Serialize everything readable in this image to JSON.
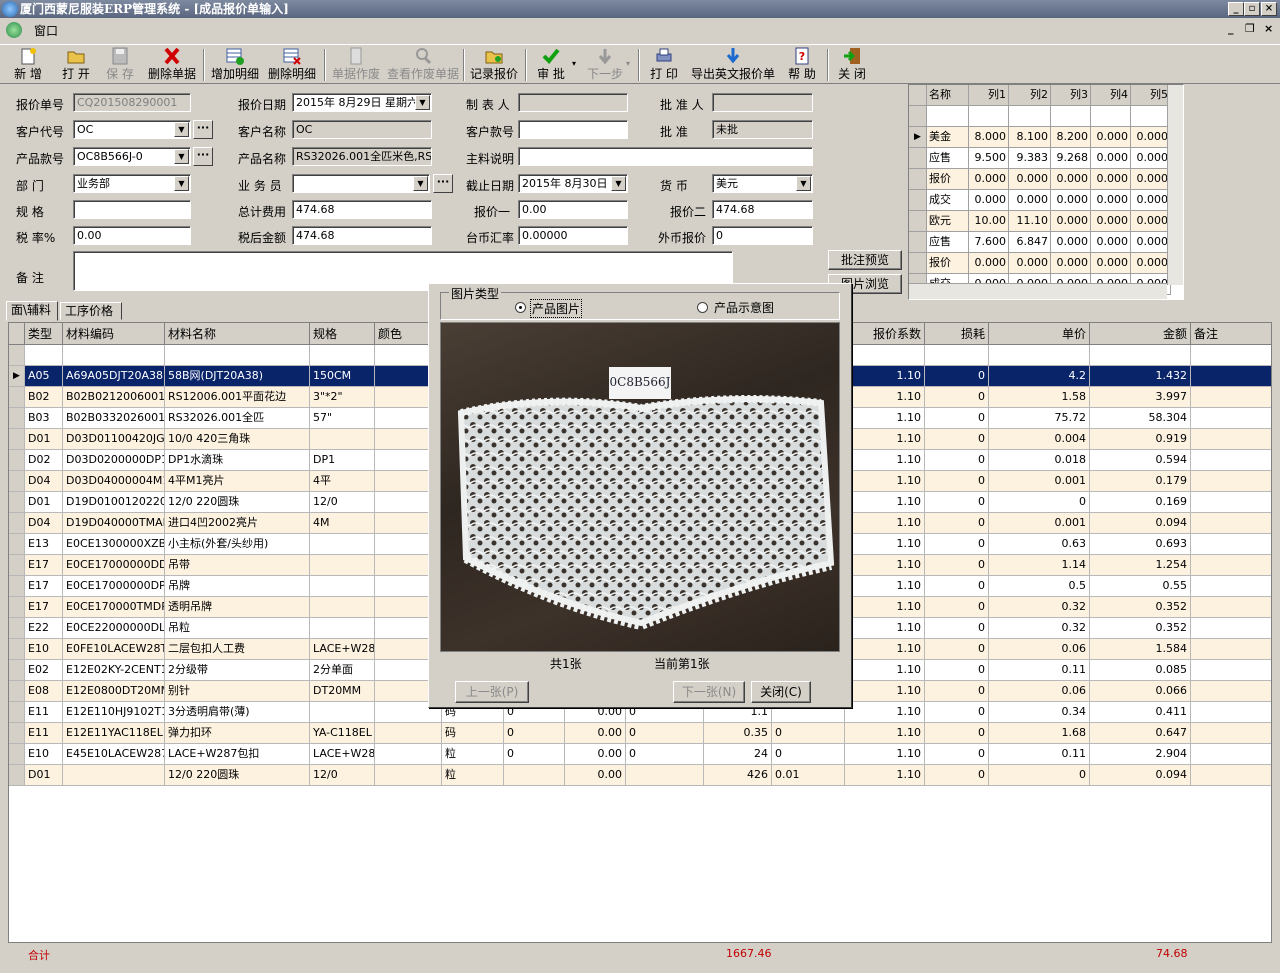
{
  "window": {
    "title": "厦门西蒙尼服装ERP管理系统 - [成品报价单输入]",
    "menu": "窗口"
  },
  "toolbar": [
    {
      "label": "新  增",
      "icon": "new-icon",
      "enabled": true
    },
    {
      "label": "打  开",
      "icon": "open-icon",
      "enabled": true
    },
    {
      "label": "保  存",
      "icon": "save-icon",
      "enabled": false
    },
    {
      "label": "删除单据",
      "icon": "delete-icon",
      "enabled": true
    },
    {
      "label": "增加明细",
      "icon": "add-row-icon",
      "enabled": true
    },
    {
      "label": "删除明细",
      "icon": "delete-row-icon",
      "enabled": true
    },
    {
      "label": "单据作废",
      "icon": "void-icon",
      "enabled": false
    },
    {
      "label": "查看作废单据",
      "icon": "view-void-icon",
      "enabled": false
    },
    {
      "label": "记录报价",
      "icon": "record-icon",
      "enabled": true
    },
    {
      "label": "审  批",
      "icon": "approve-icon",
      "enabled": true
    },
    {
      "label": "下一步",
      "icon": "next-step-icon",
      "enabled": false
    },
    {
      "label": "打  印",
      "icon": "print-icon",
      "enabled": true
    },
    {
      "label": "导出英文报价单",
      "icon": "export-icon",
      "enabled": true
    },
    {
      "label": "帮  助",
      "icon": "help-icon",
      "enabled": true
    },
    {
      "label": "关  闭",
      "icon": "close-icon",
      "enabled": true
    }
  ],
  "form": {
    "quote_no": {
      "label": "报价单号",
      "value": "CQ201508290001"
    },
    "quote_date": {
      "label": "报价日期",
      "value": "2015年 8月29日 星期六"
    },
    "maker": {
      "label": "制 表 人",
      "value": ""
    },
    "approver": {
      "label": "批 准 人",
      "value": ""
    },
    "customer_code": {
      "label": "客户代号",
      "value": "OC"
    },
    "customer_name": {
      "label": "客户名称",
      "value": "OC"
    },
    "customer_style": {
      "label": "客户款号",
      "value": ""
    },
    "approval": {
      "label": "批    准",
      "value": "未批"
    },
    "product_style": {
      "label": "产品款号",
      "value": "OC8B566J-0"
    },
    "product_name": {
      "label": "产品名称",
      "value": "RS32026.001全匹米色,RS1"
    },
    "material_note": {
      "label": "主料说明",
      "value": ""
    },
    "dept": {
      "label": "部    门",
      "value": "业务部"
    },
    "salesman": {
      "label": "业 务 员",
      "value": ""
    },
    "deadline": {
      "label": "截止日期",
      "value": "2015年 8月30日"
    },
    "currency": {
      "label": "货    币",
      "value": "美元"
    },
    "spec": {
      "label": "规    格",
      "value": ""
    },
    "total_cost": {
      "label": "总计费用",
      "value": "474.68"
    },
    "price1": {
      "label": "报价一",
      "value": "0.00"
    },
    "price2": {
      "label": "报价二",
      "value": "474.68"
    },
    "tax_rate": {
      "label": "税    率%",
      "value": "0.00"
    },
    "after_tax": {
      "label": "税后金额",
      "value": "474.68"
    },
    "twd_rate": {
      "label": "台币汇率",
      "value": "0.00000"
    },
    "fx_price": {
      "label": "外币报价",
      "value": "0"
    },
    "remark": {
      "label": "备    注",
      "value": ""
    },
    "approve_preview": "批注预览",
    "photo_browse": "图片浏览"
  },
  "summary_grid": {
    "headers": [
      "名称",
      "列1",
      "列2",
      "列3",
      "列4",
      "列5"
    ],
    "rows": [
      [
        "美金",
        "8.000",
        "8.100",
        "8.200",
        "0.000",
        "0.000"
      ],
      [
        "应售",
        "9.500",
        "9.383",
        "9.268",
        "0.000",
        "0.000"
      ],
      [
        "报价",
        "0.000",
        "0.000",
        "0.000",
        "0.000",
        "0.000"
      ],
      [
        "成交",
        "0.000",
        "0.000",
        "0.000",
        "0.000",
        "0.000"
      ],
      [
        "欧元",
        "10.00",
        "11.10",
        "0.000",
        "0.000",
        "0.000"
      ],
      [
        "应售",
        "7.600",
        "6.847",
        "0.000",
        "0.000",
        "0.000"
      ],
      [
        "报价",
        "0.000",
        "0.000",
        "0.000",
        "0.000",
        "0.000"
      ],
      [
        "成交",
        "0.000",
        "0.000",
        "0.000",
        "0.000",
        "0.000"
      ]
    ]
  },
  "tabs": [
    "面\\辅料",
    "工序价格"
  ],
  "grid": {
    "headers": [
      "类型",
      "材料编码",
      "材料名称",
      "规格",
      "颜色",
      "报价系数",
      "损耗",
      "单价",
      "金额",
      "备注"
    ],
    "rows": [
      [
        "A05",
        "A69A05DJT20A381",
        "58B网(DJT20A38)",
        "150CM",
        "",
        "1.10",
        "0",
        "4.2",
        "1.432",
        ""
      ],
      [
        "B02",
        "B02B02120060011",
        "RS12006.001平面花边",
        "3\"*2\"",
        "",
        "1.10",
        "0",
        "1.58",
        "3.997",
        ""
      ],
      [
        "B03",
        "B02B03320260011",
        "RS32026.001全匹",
        "57\"",
        "",
        "1.10",
        "0",
        "75.72",
        "58.304",
        ""
      ],
      [
        "D01",
        "D03D01100420JG1",
        "10/0 420三角珠",
        "",
        "",
        "1.10",
        "0",
        "0.004",
        "0.919",
        ""
      ],
      [
        "D02",
        "D03D0200000DP11",
        "DP1水滴珠",
        "DP1",
        "",
        "1.10",
        "0",
        "0.018",
        "0.594",
        ""
      ],
      [
        "D04",
        "D03D04000004M11",
        "4平M1亮片",
        "4平",
        "",
        "1.10",
        "0",
        "0.001",
        "0.179",
        ""
      ],
      [
        "D01",
        "D19D01001202201",
        "12/0 220圆珠",
        "12/0",
        "",
        "1.10",
        "0",
        "0",
        "0.169",
        ""
      ],
      [
        "D04",
        "D19D040000TMAP1",
        "进口4凹2002亮片",
        "4M",
        "",
        "1.10",
        "0",
        "0.001",
        "0.094",
        ""
      ],
      [
        "E13",
        "E0CE1300000XZB2",
        "小主标(外套/头纱用)",
        "",
        "",
        "1.10",
        "0",
        "0.63",
        "0.693",
        ""
      ],
      [
        "E17",
        "E0CE17000000DD2",
        "吊带",
        "",
        "",
        "1.10",
        "0",
        "1.14",
        "1.254",
        ""
      ],
      [
        "E17",
        "E0CE17000000DP2",
        "吊牌",
        "",
        "",
        "1.10",
        "0",
        "0.5",
        "0.55",
        ""
      ],
      [
        "E17",
        "E0CE170000TMDP2",
        "透明吊牌",
        "",
        "",
        "1.10",
        "0",
        "0.32",
        "0.352",
        ""
      ],
      [
        "E22",
        "E0CE22000000DL2",
        "吊粒",
        "",
        "",
        "1.10",
        "0",
        "0.32",
        "0.352",
        ""
      ],
      [
        "E10",
        "E0FE10LACEW28T1",
        "二层包扣人工费",
        "LACE+W287",
        "",
        "1.10",
        "0",
        "0.06",
        "1.584",
        ""
      ],
      [
        "E02",
        "E12E02KY-2CENT1",
        "2分级带",
        "2分单面",
        "",
        "1.10",
        "0",
        "0.11",
        "0.085",
        ""
      ],
      [
        "E08",
        "E12E0800DT20MM1",
        "别针",
        "DT20MM",
        "",
        "1.10",
        "0",
        "0.06",
        "0.066",
        ""
      ],
      [
        "E11",
        "E12E110HJ9102T1",
        "3分透明肩带(薄)",
        "",
        "",
        "1.10",
        "0",
        "0.34",
        "0.411",
        ""
      ],
      [
        "E11",
        "E12E11YAC118EL1",
        "弹力扣环",
        "YA-C118EL",
        "",
        "1.10",
        "0",
        "1.68",
        "0.647",
        ""
      ],
      [
        "E10",
        "E45E10LACEW2871",
        "LACE+W287包扣",
        "LACE+W287",
        "",
        "1.10",
        "0",
        "0.11",
        "2.904",
        ""
      ],
      [
        "D01",
        "",
        "12/0 220圆珠",
        "12/0",
        "",
        "1.10",
        "0",
        "0",
        "0.094",
        ""
      ]
    ],
    "mid": [
      [
        "",
        "",
        "",
        "",
        "",
        ""
      ],
      [
        "",
        "",
        "",
        "",
        "",
        ""
      ],
      [
        "",
        "",
        "",
        "",
        "",
        ""
      ],
      [
        "",
        "",
        "",
        "",
        "",
        ""
      ],
      [
        "",
        "",
        "",
        "",
        "",
        ""
      ],
      [
        "",
        "",
        "",
        "",
        "",
        ""
      ],
      [
        "",
        "",
        "",
        "",
        "",
        ""
      ],
      [
        "",
        "",
        "",
        "",
        "",
        ""
      ],
      [
        "",
        "",
        "",
        "",
        "",
        ""
      ],
      [
        "",
        "",
        "",
        "",
        "",
        ""
      ],
      [
        "",
        "",
        "",
        "",
        "",
        ""
      ],
      [
        "",
        "",
        "",
        "",
        "",
        ""
      ],
      [
        "",
        "",
        "",
        "",
        "",
        ""
      ],
      [
        "",
        "",
        "",
        "",
        "",
        ""
      ],
      [
        "",
        "",
        "",
        "",
        "",
        ""
      ],
      [
        "",
        "",
        "",
        "",
        "",
        ""
      ],
      [
        "码",
        "0",
        "0.00",
        "0",
        "1.1",
        ""
      ],
      [
        "码",
        "0",
        "0.00",
        "0",
        "0.35",
        "0"
      ],
      [
        "粒",
        "0",
        "0.00",
        "0",
        "24",
        "0"
      ],
      [
        "粒",
        "",
        "0.00",
        "",
        "426",
        "0.01"
      ]
    ],
    "footer": {
      "label": "合计",
      "sum1": "1667.46",
      "sum2": "74.68"
    }
  },
  "dialog": {
    "group_title": "图片类型",
    "opt1": "产品图片",
    "opt2": "产品示意图",
    "total": "共1张",
    "current": "当前第1张",
    "prev": "上一张(P)",
    "next": "下一张(N)",
    "close": "关闭(C)",
    "tag_text": "0C8B566J"
  }
}
